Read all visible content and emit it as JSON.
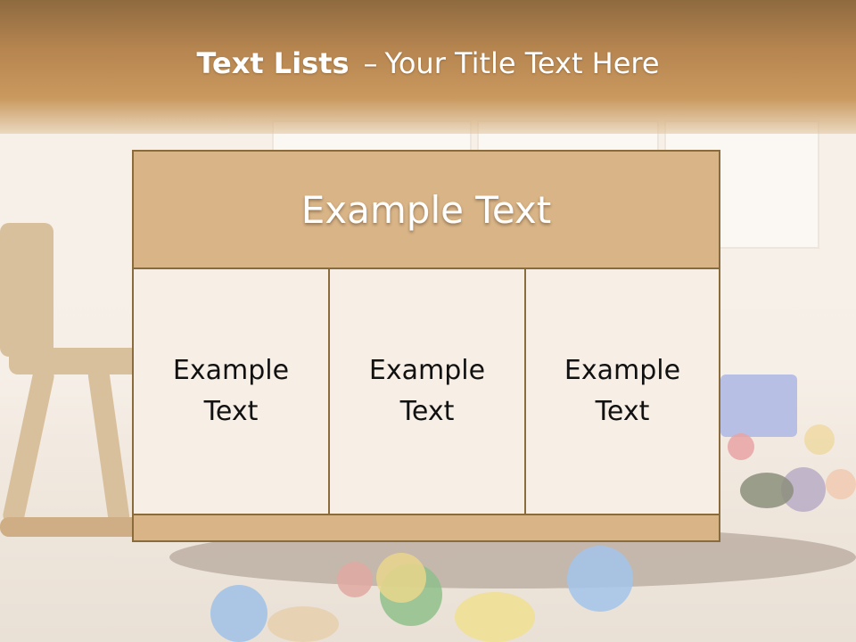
{
  "slide": {
    "title_bold": "Text Lists",
    "title_separator": "–",
    "title_rest": "Your Title Text Here"
  },
  "table": {
    "header": "Example Text",
    "cells": [
      "Example Text",
      "Example Text",
      "Example Text"
    ]
  },
  "colors": {
    "header_band": "#b68550",
    "table_header": "#d8b487",
    "table_border": "#8a6b3c",
    "table_cell": "#f7efe6"
  }
}
